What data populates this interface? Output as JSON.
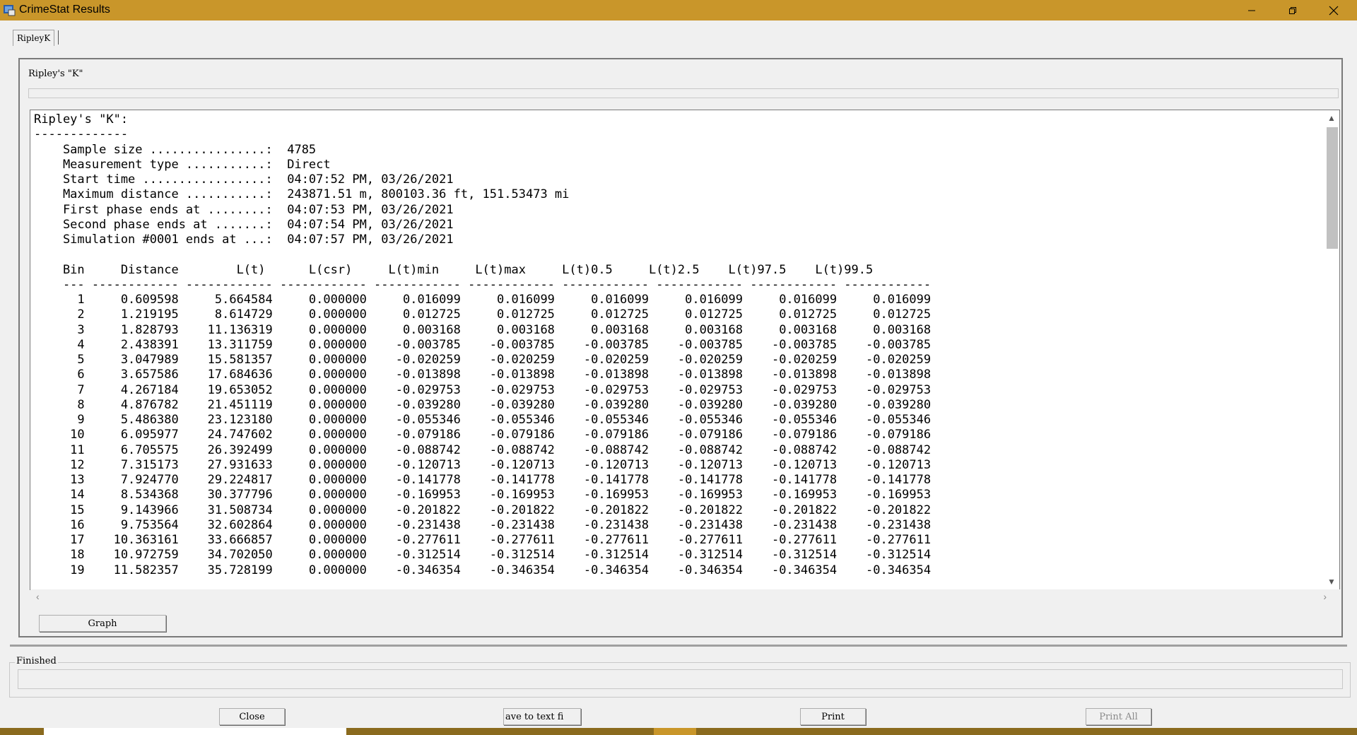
{
  "window": {
    "title": "CrimeStat Results"
  },
  "tabs": [
    {
      "label": "RipleyK"
    }
  ],
  "panel": {
    "heading": "Ripley's \"K\""
  },
  "report": {
    "text": "Ripley's \"K\":\n-------------\n    Sample size ................:  4785\n    Measurement type ...........:  Direct\n    Start time .................:  04:07:52 PM, 03/26/2021\n    Maximum distance ...........:  243871.51 m, 800103.36 ft, 151.53473 mi\n    First phase ends at ........:  04:07:53 PM, 03/26/2021\n    Second phase ends at .......:  04:07:54 PM, 03/26/2021\n    Simulation #0001 ends at ...:  04:07:57 PM, 03/26/2021\n\n    Bin     Distance        L(t)      L(csr)     L(t)min     L(t)max     L(t)0.5     L(t)2.5    L(t)97.5    L(t)99.5\n    --- ------------ ------------ ------------ ------------ ------------ ------------ ------------ ------------ ------------\n      1     0.609598     5.664584     0.000000     0.016099     0.016099     0.016099     0.016099     0.016099     0.016099\n      2     1.219195     8.614729     0.000000     0.012725     0.012725     0.012725     0.012725     0.012725     0.012725\n      3     1.828793    11.136319     0.000000     0.003168     0.003168     0.003168     0.003168     0.003168     0.003168\n      4     2.438391    13.311759     0.000000    -0.003785    -0.003785    -0.003785    -0.003785    -0.003785    -0.003785\n      5     3.047989    15.581357     0.000000    -0.020259    -0.020259    -0.020259    -0.020259    -0.020259    -0.020259\n      6     3.657586    17.684636     0.000000    -0.013898    -0.013898    -0.013898    -0.013898    -0.013898    -0.013898\n      7     4.267184    19.653052     0.000000    -0.029753    -0.029753    -0.029753    -0.029753    -0.029753    -0.029753\n      8     4.876782    21.451119     0.000000    -0.039280    -0.039280    -0.039280    -0.039280    -0.039280    -0.039280\n      9     5.486380    23.123180     0.000000    -0.055346    -0.055346    -0.055346    -0.055346    -0.055346    -0.055346\n     10     6.095977    24.747602     0.000000    -0.079186    -0.079186    -0.079186    -0.079186    -0.079186    -0.079186\n     11     6.705575    26.392499     0.000000    -0.088742    -0.088742    -0.088742    -0.088742    -0.088742    -0.088742\n     12     7.315173    27.931633     0.000000    -0.120713    -0.120713    -0.120713    -0.120713    -0.120713    -0.120713\n     13     7.924770    29.224817     0.000000    -0.141778    -0.141778    -0.141778    -0.141778    -0.141778    -0.141778\n     14     8.534368    30.377796     0.000000    -0.169953    -0.169953    -0.169953    -0.169953    -0.169953    -0.169953\n     15     9.143966    31.508734     0.000000    -0.201822    -0.201822    -0.201822    -0.201822    -0.201822    -0.201822\n     16     9.753564    32.602864     0.000000    -0.231438    -0.231438    -0.231438    -0.231438    -0.231438    -0.231438\n     17    10.363161    33.666857     0.000000    -0.277611    -0.277611    -0.277611    -0.277611    -0.277611    -0.277611\n     18    10.972759    34.702050     0.000000    -0.312514    -0.312514    -0.312514    -0.312514    -0.312514    -0.312514\n     19    11.582357    35.728199     0.000000    -0.346354    -0.346354    -0.346354    -0.346354    -0.346354    -0.346354"
  },
  "buttons": {
    "graph": "Graph",
    "close": "Close",
    "save": "ave to text fi",
    "print": "Print",
    "print_all": "Print All"
  },
  "status": {
    "group_label": "Finished"
  }
}
